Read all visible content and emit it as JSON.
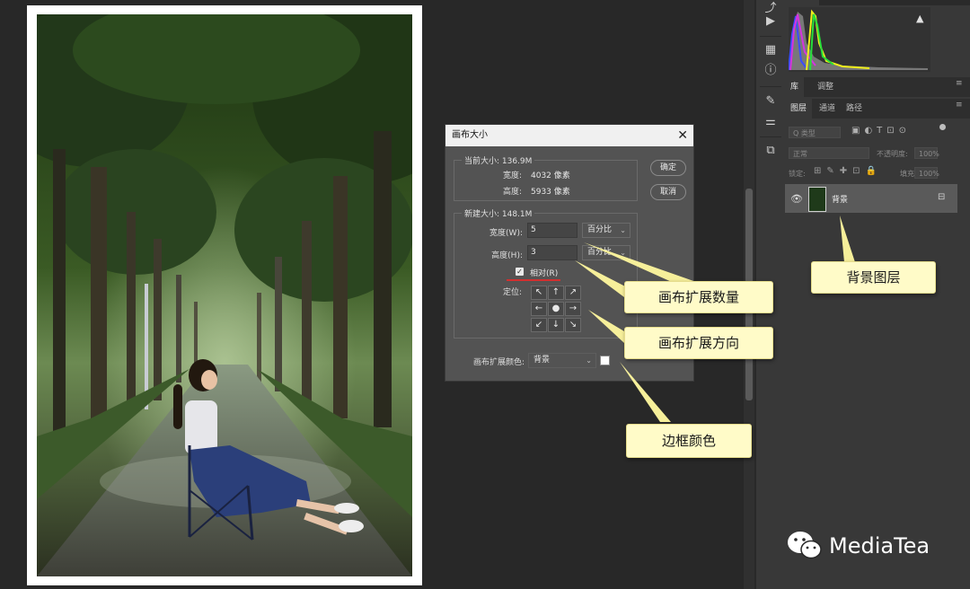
{
  "dialog": {
    "title": "画布大小",
    "current_size_label": "当前大小: 136.9M",
    "current_width_label": "宽度:",
    "current_width_value": "4032 像素",
    "current_height_label": "高度:",
    "current_height_value": "5933 像素",
    "new_size_label": "新建大小: 148.1M",
    "width_label": "宽度(W):",
    "width_value": "5",
    "width_unit": "百分比",
    "height_label": "高度(H):",
    "height_value": "3",
    "height_unit": "百分比",
    "relative_label": "相对(R)",
    "relative_checked": true,
    "anchor_label": "定位:",
    "extension_color_label": "画布扩展颜色:",
    "extension_color_value": "背景",
    "extension_color_swatch": "#ffffff",
    "ok_label": "确定",
    "cancel_label": "取消"
  },
  "anchor_grid": [
    "↖",
    "↑",
    "↗",
    "←",
    "●",
    "→",
    "↙",
    "↓",
    "↘"
  ],
  "callouts": {
    "canvas_amount": "画布扩展数量",
    "canvas_direction": "画布扩展方向",
    "border_color": "边框颜色",
    "background_layer": "背景图层"
  },
  "right_panel": {
    "tabs_top": [
      "库",
      "调整"
    ],
    "tabs_layers": [
      "图层",
      "通道",
      "路径"
    ],
    "kind_placeholder": "Q 类型",
    "blend_mode": "正常",
    "opacity_label": "不透明度:",
    "opacity_value": "100%",
    "lock_label": "锁定:",
    "fill_label": "填充:",
    "fill_value": "100%",
    "layer_name": "背景"
  },
  "watermark": "MediaTea",
  "colors": {
    "callout_bg": "#fffbc8",
    "leader_line": "#f6ef9a",
    "underline": "#d32f2f",
    "dialog_bg": "#535353",
    "app_bg": "#282828"
  },
  "icons": [
    "play-icon",
    "histogram-icon",
    "info-icon",
    "brush-icon",
    "adjust-icon",
    "layer-icon",
    "eye-icon",
    "lock-icon",
    "close-icon",
    "warning-icon",
    "wechat-icon"
  ]
}
